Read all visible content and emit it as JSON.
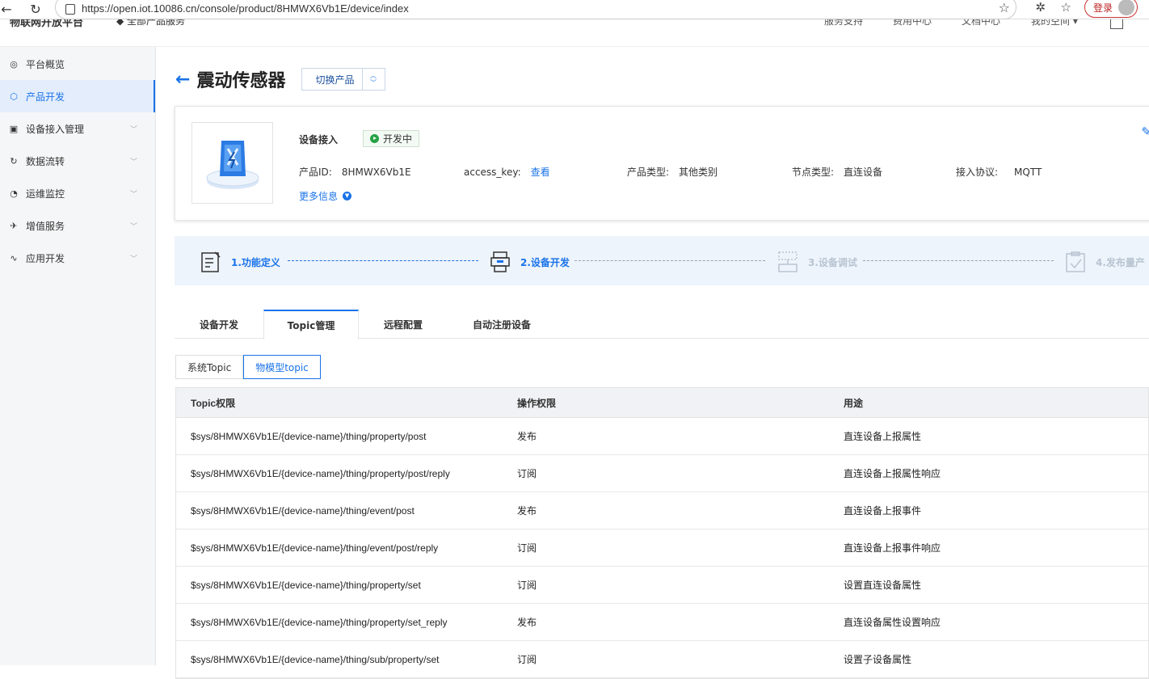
{
  "browser": {
    "url": "https://open.iot.10086.cn/console/product/8HMWX6Vb1E/device/index",
    "login_label": "登录"
  },
  "site": {
    "brand": "物联网开放平台",
    "all_services": "全部产品服务",
    "links": [
      "服务支持",
      "费用中心",
      "文档中心",
      "我的空间 ▾"
    ]
  },
  "sidebar": {
    "items": [
      {
        "label": "平台概览",
        "icon": "overview-icon",
        "glyph": "◎"
      },
      {
        "label": "产品开发",
        "icon": "cube-icon",
        "glyph": "⬡"
      },
      {
        "label": "设备接入管理",
        "icon": "device-icon",
        "glyph": "▣"
      },
      {
        "label": "数据流转",
        "icon": "flow-icon",
        "glyph": "↻"
      },
      {
        "label": "运维监控",
        "icon": "monitor-icon",
        "glyph": "◔"
      },
      {
        "label": "增值服务",
        "icon": "plane-icon",
        "glyph": "✈"
      },
      {
        "label": "应用开发",
        "icon": "app-icon",
        "glyph": "∿"
      }
    ],
    "active_index": 1
  },
  "product": {
    "title": "震动传感器",
    "switch_label": "切换产品",
    "access_label": "设备接入",
    "status": "开发中",
    "id_label": "产品ID:",
    "id_value": "8HMWX6Vb1E",
    "key_label": "access_key:",
    "key_link": "查看",
    "type_label": "产品类型:",
    "type_value": "其他类别",
    "node_label": "节点类型:",
    "node_value": "直连设备",
    "proto_label": "接入协议:",
    "proto_value": "MQTT",
    "more_info": "更多信息"
  },
  "steps": [
    {
      "label": "1.功能定义",
      "state": "done"
    },
    {
      "label": "2.设备开发",
      "state": "done"
    },
    {
      "label": "3.设备调试",
      "state": "todo"
    },
    {
      "label": "4.发布量产",
      "state": "todo"
    }
  ],
  "tabs": [
    "设备开发",
    "Topic管理",
    "远程配置",
    "自动注册设备"
  ],
  "active_tab": 1,
  "subtabs": [
    "系统Topic",
    "物模型topic"
  ],
  "active_subtab": 1,
  "table": {
    "headers": [
      "Topic权限",
      "操作权限",
      "用途"
    ],
    "rows": [
      [
        "$sys/8HMWX6Vb1E/{device-name}/thing/property/post",
        "发布",
        "直连设备上报属性"
      ],
      [
        "$sys/8HMWX6Vb1E/{device-name}/thing/property/post/reply",
        "订阅",
        "直连设备上报属性响应"
      ],
      [
        "$sys/8HMWX6Vb1E/{device-name}/thing/event/post",
        "发布",
        "直连设备上报事件"
      ],
      [
        "$sys/8HMWX6Vb1E/{device-name}/thing/event/post/reply",
        "订阅",
        "直连设备上报事件响应"
      ],
      [
        "$sys/8HMWX6Vb1E/{device-name}/thing/property/set",
        "订阅",
        "设置直连设备属性"
      ],
      [
        "$sys/8HMWX6Vb1E/{device-name}/thing/property/set_reply",
        "发布",
        "直连设备属性设置响应"
      ],
      [
        "$sys/8HMWX6Vb1E/{device-name}/thing/sub/property/set",
        "订阅",
        "设置子设备属性"
      ]
    ]
  },
  "colors": {
    "accent": "#1a73e8",
    "status_green": "#25a244",
    "steps_bg": "#eef4fb"
  }
}
